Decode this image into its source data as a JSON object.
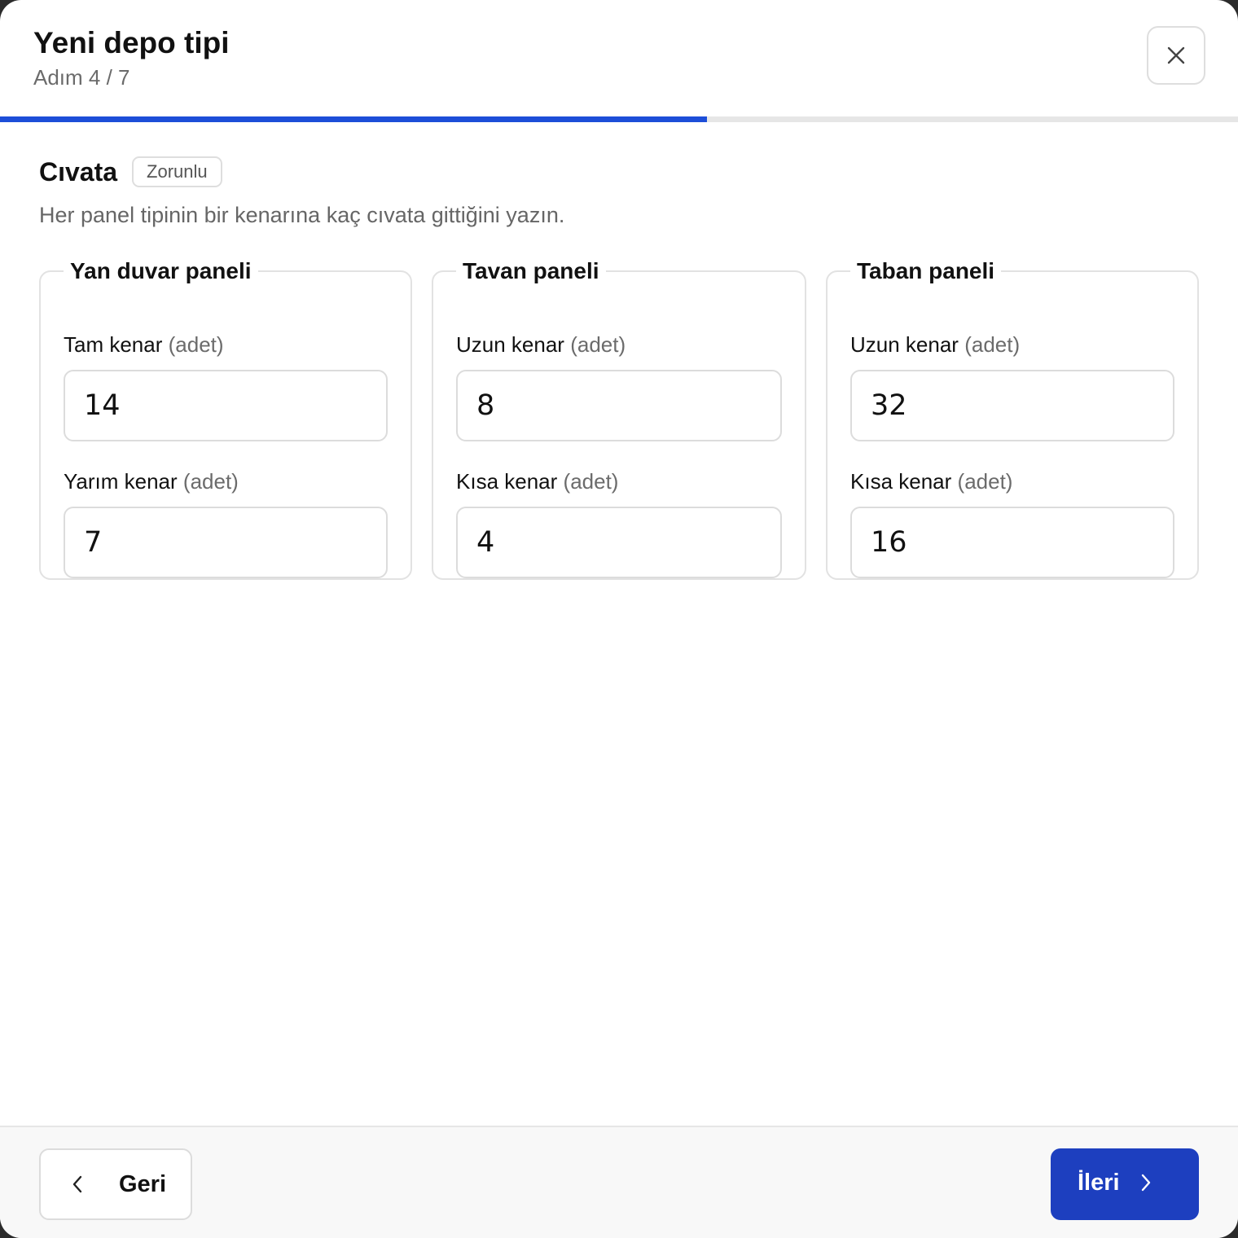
{
  "dialog": {
    "title": "Yeni depo tipi",
    "step_text": "Adım 4 / 7",
    "close_icon": "close-icon",
    "progress": {
      "current_step": 4,
      "total_steps": 7,
      "fraction": 0.571,
      "color": "#1d4ed8"
    }
  },
  "section": {
    "title": "Cıvata",
    "badge": "Zorunlu",
    "hint": "Her panel tipinin bir kenarına kaç cıvata gittiğini yazın."
  },
  "panels": [
    {
      "legend": "Yan duvar paneli",
      "fields": [
        {
          "label": "Tam kenar",
          "unit": "(adet)",
          "value": "14"
        },
        {
          "label": "Yarım kenar",
          "unit": "(adet)",
          "value": "7"
        }
      ]
    },
    {
      "legend": "Tavan paneli",
      "fields": [
        {
          "label": "Uzun kenar",
          "unit": "(adet)",
          "value": "8"
        },
        {
          "label": "Kısa kenar",
          "unit": "(adet)",
          "value": "4"
        }
      ]
    },
    {
      "legend": "Taban paneli",
      "fields": [
        {
          "label": "Uzun kenar",
          "unit": "(adet)",
          "value": "32"
        },
        {
          "label": "Kısa kenar",
          "unit": "(adet)",
          "value": "16"
        }
      ]
    }
  ],
  "footer": {
    "back_label": "Geri",
    "back_icon": "chevron-left-icon",
    "next_label": "İleri",
    "next_icon": "chevron-right-icon",
    "next_color": "#1d3fbf"
  }
}
